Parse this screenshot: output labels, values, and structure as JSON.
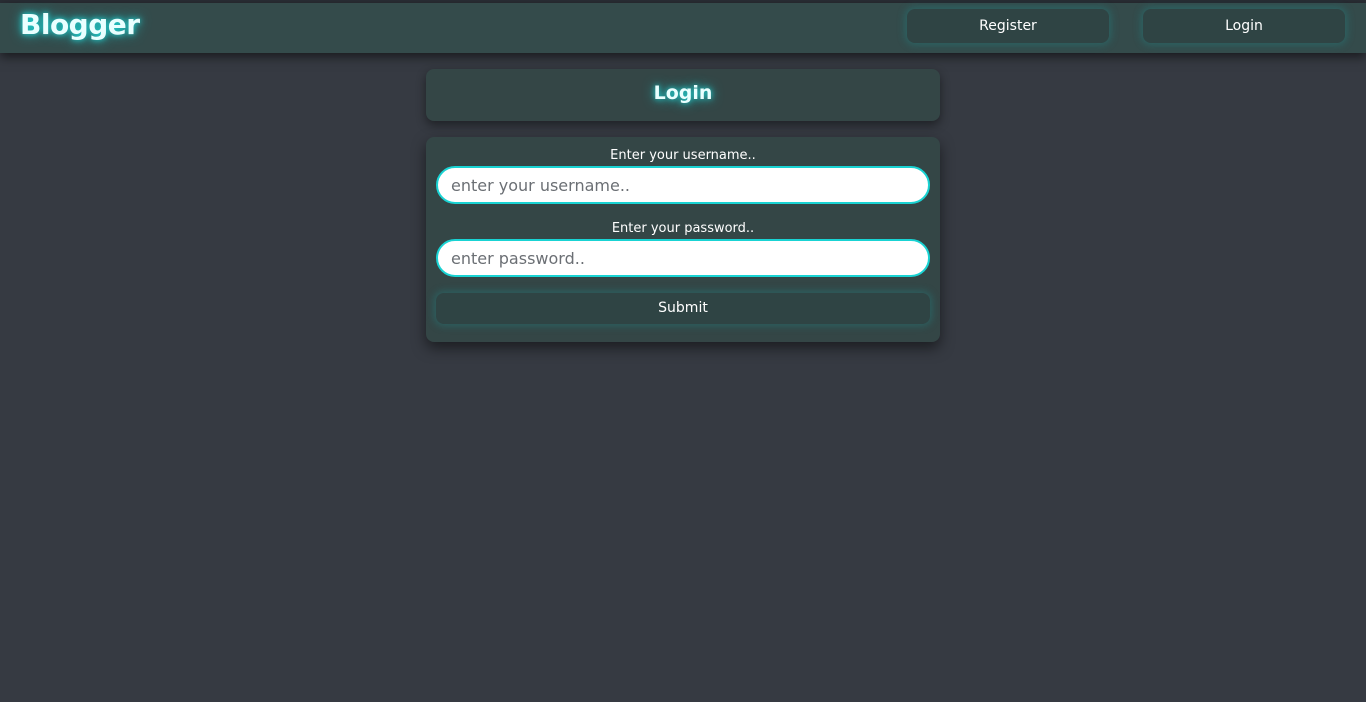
{
  "navbar": {
    "brand": "Blogger",
    "links": [
      {
        "label": "Register"
      },
      {
        "label": "Login"
      }
    ]
  },
  "page": {
    "title": "Login"
  },
  "form": {
    "username": {
      "label": "Enter your username..",
      "placeholder": "enter your username..",
      "value": ""
    },
    "password": {
      "label": "Enter your password..",
      "placeholder": "enter password..",
      "value": ""
    },
    "submit_label": "Submit"
  },
  "colors": {
    "background": "#363a42",
    "navbar": "#344b4b",
    "card": "#344646",
    "accent": "#19d3d3"
  }
}
